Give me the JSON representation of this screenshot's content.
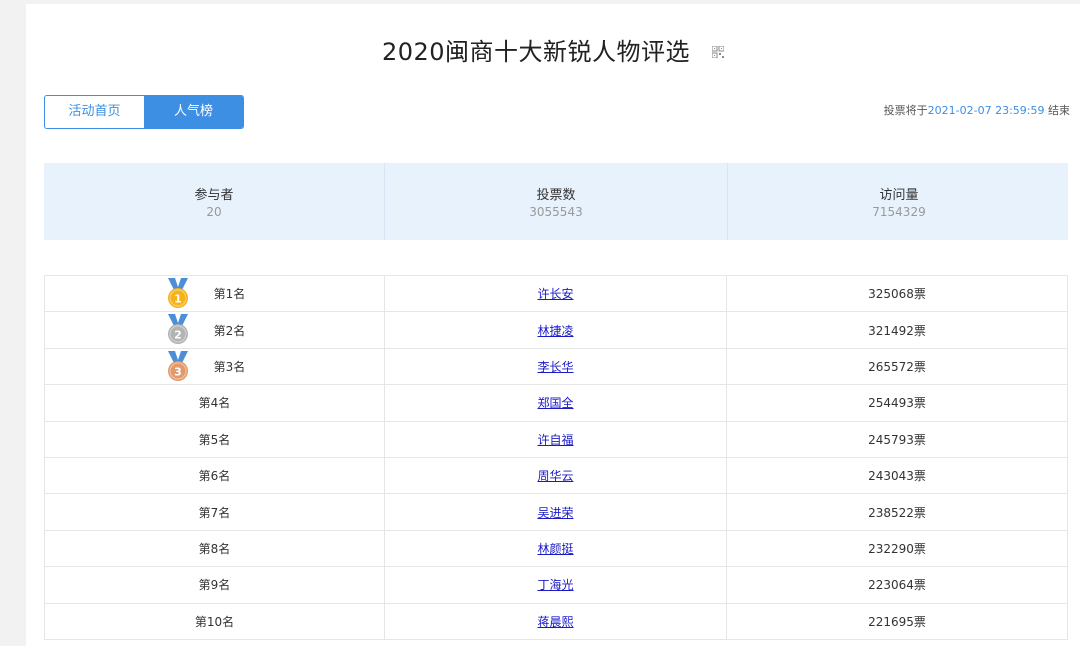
{
  "page": {
    "title": "2020闽商十大新锐人物评选",
    "tabs": [
      {
        "label": "活动首页"
      },
      {
        "label": "人气榜"
      }
    ],
    "deadline": {
      "prefix": "投票将于",
      "date": "2021-02-07 23:59:59",
      "suffix": "结束"
    }
  },
  "stats": [
    {
      "label": "参与者",
      "value": "20"
    },
    {
      "label": "投票数",
      "value": "3055543"
    },
    {
      "label": "访问量",
      "value": "7154329"
    }
  ],
  "ranking": [
    {
      "rank": "第1名",
      "name": "许长安",
      "votes": "325068票",
      "medal": "gold",
      "medal_num": "1"
    },
    {
      "rank": "第2名",
      "name": "林捷凌",
      "votes": "321492票",
      "medal": "silver",
      "medal_num": "2"
    },
    {
      "rank": "第3名",
      "name": "李长华",
      "votes": "265572票",
      "medal": "bronze",
      "medal_num": "3"
    },
    {
      "rank": "第4名",
      "name": "郑国全",
      "votes": "254493票"
    },
    {
      "rank": "第5名",
      "name": "许自福",
      "votes": "245793票"
    },
    {
      "rank": "第6名",
      "name": "周华云",
      "votes": "243043票"
    },
    {
      "rank": "第7名",
      "name": "吴进荣",
      "votes": "238522票"
    },
    {
      "rank": "第8名",
      "name": "林颜挺",
      "votes": "232290票"
    },
    {
      "rank": "第9名",
      "name": "丁海光",
      "votes": "223064票"
    },
    {
      "rank": "第10名",
      "name": "蒋晨熙",
      "votes": "221695票"
    }
  ],
  "colors": {
    "accent": "#3d8fe3",
    "stats_bg": "#e8f2fd",
    "link": "#1a1ac8",
    "gold": "#f5b21b",
    "silver": "#b3b3b3",
    "bronze": "#e39a6a",
    "ribbon": "#4a8fd8"
  }
}
